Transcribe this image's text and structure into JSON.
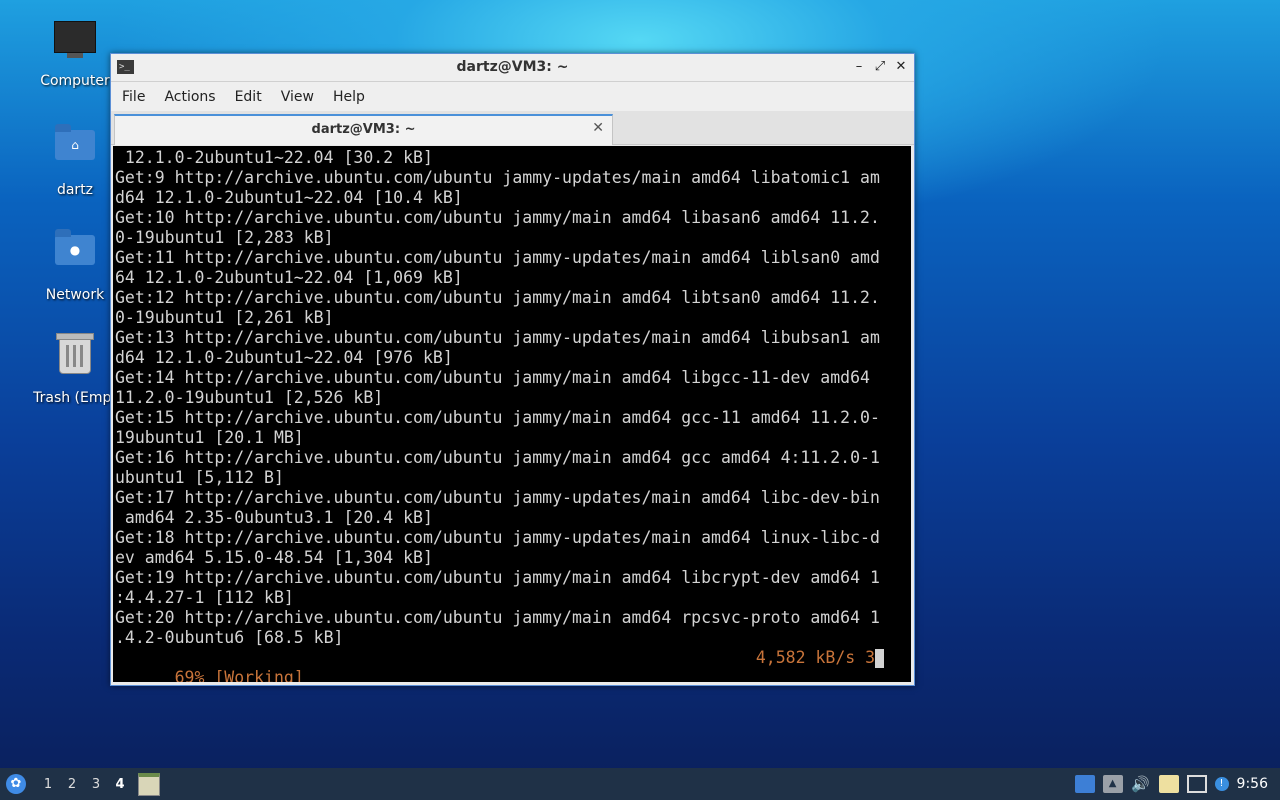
{
  "desktop": {
    "icons": [
      {
        "label": "Computer",
        "icon": "computer-icon"
      },
      {
        "label": "dartz",
        "icon": "home-folder-icon"
      },
      {
        "label": "Network",
        "icon": "network-folder-icon"
      },
      {
        "label": "Trash (Empt",
        "icon": "trash-icon"
      }
    ]
  },
  "window": {
    "title": "dartz@VM3: ~",
    "controls": {
      "minimize": "–",
      "maximize": "⤢",
      "close": "✕"
    },
    "menu": [
      "File",
      "Actions",
      "Edit",
      "View",
      "Help"
    ],
    "tab": {
      "title": "dartz@VM3: ~",
      "close": "✕"
    },
    "terminal": {
      "lines": [
        " 12.1.0-2ubuntu1~22.04 [30.2 kB]",
        "Get:9 http://archive.ubuntu.com/ubuntu jammy-updates/main amd64 libatomic1 am",
        "d64 12.1.0-2ubuntu1~22.04 [10.4 kB]",
        "Get:10 http://archive.ubuntu.com/ubuntu jammy/main amd64 libasan6 amd64 11.2.",
        "0-19ubuntu1 [2,283 kB]",
        "Get:11 http://archive.ubuntu.com/ubuntu jammy-updates/main amd64 liblsan0 amd",
        "64 12.1.0-2ubuntu1~22.04 [1,069 kB]",
        "Get:12 http://archive.ubuntu.com/ubuntu jammy/main amd64 libtsan0 amd64 11.2.",
        "0-19ubuntu1 [2,261 kB]",
        "Get:13 http://archive.ubuntu.com/ubuntu jammy-updates/main amd64 libubsan1 am",
        "d64 12.1.0-2ubuntu1~22.04 [976 kB]",
        "Get:14 http://archive.ubuntu.com/ubuntu jammy/main amd64 libgcc-11-dev amd64",
        "11.2.0-19ubuntu1 [2,526 kB]",
        "Get:15 http://archive.ubuntu.com/ubuntu jammy/main amd64 gcc-11 amd64 11.2.0-",
        "19ubuntu1 [20.1 MB]",
        "Get:16 http://archive.ubuntu.com/ubuntu jammy/main amd64 gcc amd64 4:11.2.0-1",
        "ubuntu1 [5,112 B]",
        "Get:17 http://archive.ubuntu.com/ubuntu jammy-updates/main amd64 libc-dev-bin",
        " amd64 2.35-0ubuntu3.1 [20.4 kB]",
        "Get:18 http://archive.ubuntu.com/ubuntu jammy-updates/main amd64 linux-libc-d",
        "ev amd64 5.15.0-48.54 [1,304 kB]",
        "Get:19 http://archive.ubuntu.com/ubuntu jammy/main amd64 libcrypt-dev amd64 1",
        ":4.4.27-1 [112 kB]",
        "Get:20 http://archive.ubuntu.com/ubuntu jammy/main amd64 rpcsvc-proto amd64 1",
        ".4.2-0ubuntu6 [68.5 kB]"
      ],
      "status_left": "69% [Working]",
      "status_right": "4,582 kB/s 3s",
      "status_color": "#c8743a"
    }
  },
  "taskbar": {
    "workspaces": [
      "1",
      "2",
      "3",
      "4"
    ],
    "active_workspace": "4",
    "clock": "9:56",
    "tray_icons": [
      "show-desktop-icon",
      "upload-icon",
      "volume-icon",
      "clipboard-icon",
      "network-icon",
      "update-notifier-icon"
    ]
  }
}
